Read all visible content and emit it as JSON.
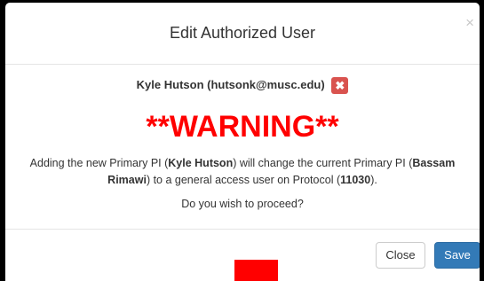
{
  "modal": {
    "title": "Edit Authorized User",
    "close_glyph": "×"
  },
  "user": {
    "display": "Kyle Hutson (hutsonk@musc.edu)",
    "remove_glyph": "✖",
    "remove_icon": "remove-x-icon"
  },
  "warning": {
    "text": "**WARNING**",
    "color": "#ff0000"
  },
  "message": {
    "part1": "Adding the new Primary PI (",
    "new_pi": "Kyle Hutson",
    "part2": ") will change the current Primary PI (",
    "current_pi": "Bassam Rimawi",
    "part3": ") to a general access user on Protocol (",
    "protocol": "11030",
    "part4": ")."
  },
  "prompt": "Do you wish to proceed?",
  "footer": {
    "close_label": "Close",
    "save_label": "Save"
  },
  "colors": {
    "danger": "#d9534f",
    "primary": "#337ab7"
  }
}
